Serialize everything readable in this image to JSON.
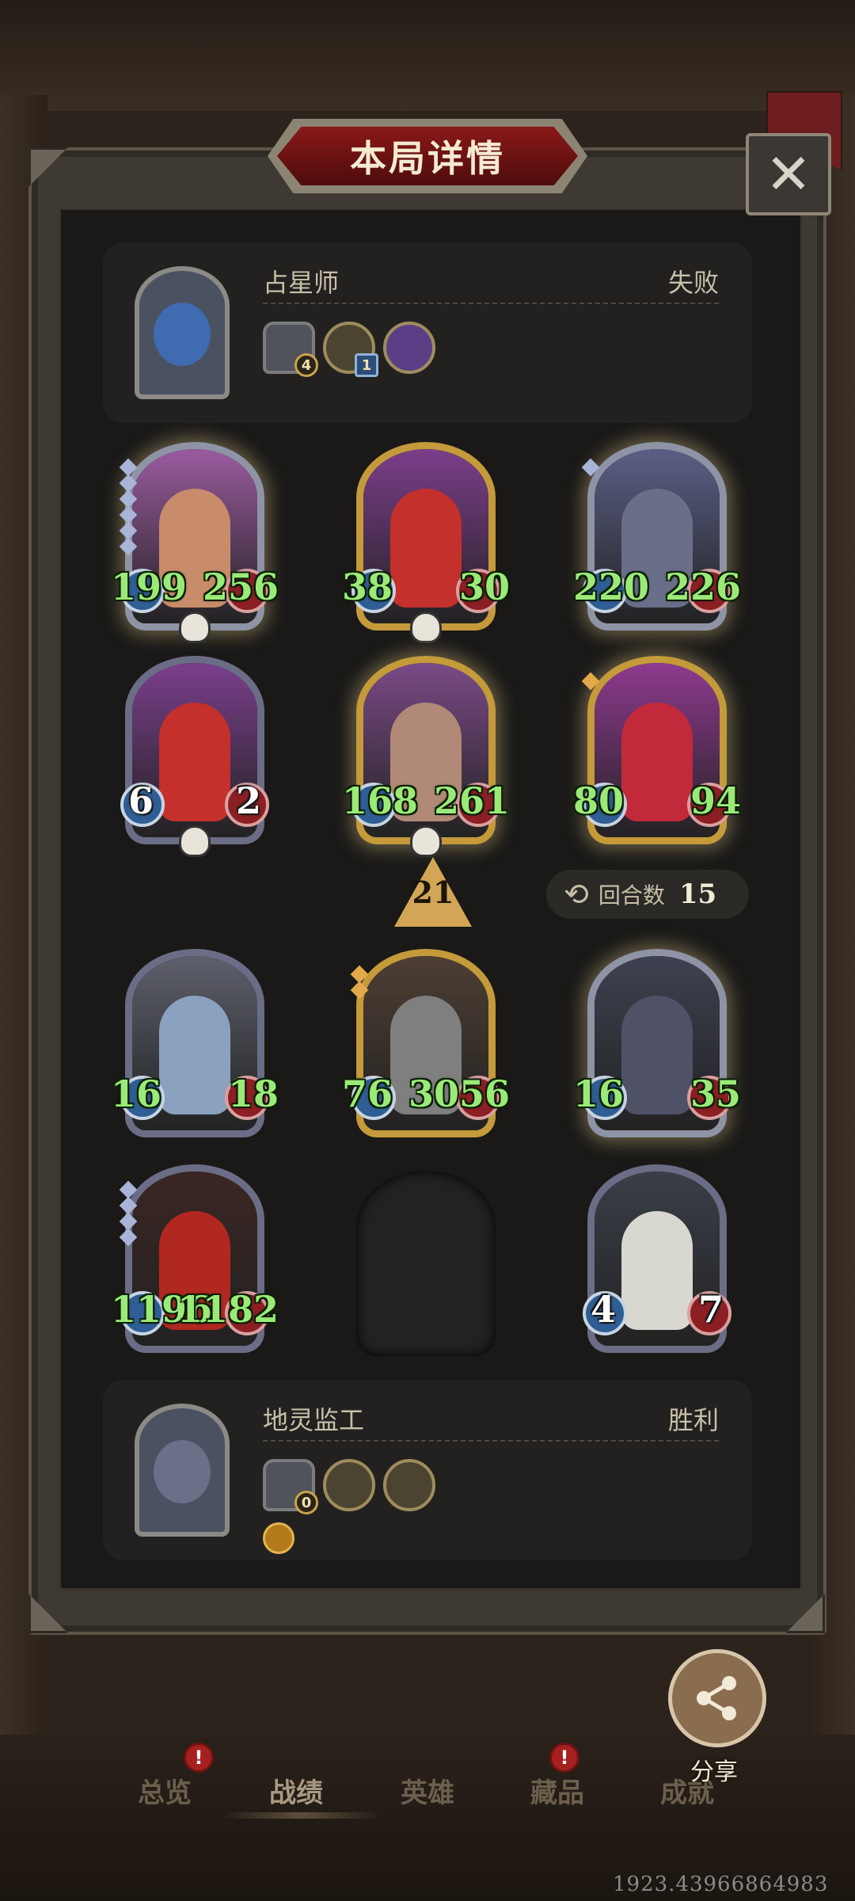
{
  "title": "本局详情",
  "close_icon": "close-icon",
  "top_player": {
    "name": "占星师",
    "result": "失败",
    "items": [
      {
        "icon": "shield-item-icon",
        "badge": "4"
      },
      {
        "icon": "orb-item-icon",
        "badge": "1"
      },
      {
        "icon": "scroll-item-icon",
        "badge": ""
      }
    ]
  },
  "units": [
    {
      "attack": "199",
      "health": "256",
      "frame": "silver",
      "art": "#9a5b9f",
      "figure": "#c98c6a",
      "glow": true,
      "tier": 6,
      "tier_color": "silver",
      "skull": true
    },
    {
      "attack": "38",
      "health": "30",
      "frame": "gold",
      "art": "#7b3e8a",
      "figure": "#c4302c",
      "glow": false,
      "tier": 0,
      "skull": true
    },
    {
      "attack": "220",
      "health": "226",
      "frame": "silver",
      "art": "#5a5f86",
      "figure": "#6a6e88",
      "glow": true,
      "tier": 1,
      "tier_color": "silver",
      "skull": false
    },
    {
      "attack": "6",
      "health": "2",
      "frame": "purple",
      "art": "#7a3f8c",
      "figure": "#c4302c",
      "glow": false,
      "tier": 0,
      "skull": true,
      "white": true
    },
    {
      "attack": "168",
      "health": "261",
      "frame": "gold",
      "art": "#7a4a86",
      "figure": "#b08a76",
      "glow": true,
      "tier": 0,
      "skull": true
    },
    {
      "attack": "80",
      "health": "94",
      "frame": "gold",
      "art": "#8e3a8e",
      "figure": "#c2293a",
      "glow": true,
      "tier": 1,
      "tier_color": "gold",
      "skull": false
    },
    {
      "attack": "16",
      "health": "18",
      "frame": "purple",
      "art": "#5d5f6b",
      "figure": "#8aa2bf",
      "glow": false,
      "tier": 0,
      "skull": false
    },
    {
      "attack": "76",
      "health": "3056",
      "frame": "gold",
      "art": "#4d3e33",
      "figure": "#7f7f7f",
      "glow": false,
      "tier": 2,
      "tier_color": "gold",
      "skull": false
    },
    {
      "attack": "16",
      "health": "35",
      "frame": "silver",
      "art": "#3e4150",
      "figure": "#4f5266",
      "glow": true,
      "tier": 0,
      "skull": false
    },
    {
      "attack": "1196",
      "health": "1182",
      "frame": "purple",
      "art": "#3b2623",
      "figure": "#b02820",
      "glow": false,
      "tier": 4,
      "tier_color": "silver",
      "skull": false
    },
    {
      "attack": "4",
      "health": "7",
      "frame": "purple",
      "art": "#3a3f48",
      "figure": "#d8d8d0",
      "glow": false,
      "tier": 0,
      "skull": false,
      "white": true
    }
  ],
  "level": "21",
  "rounds": {
    "label": "回合数",
    "value": "15",
    "icon": "refresh-icon"
  },
  "bottom_player": {
    "name": "地灵监工",
    "result": "胜利",
    "items": [
      {
        "icon": "shield-item-icon",
        "badge": "0"
      },
      {
        "icon": "lighter-item-icon",
        "badge": ""
      },
      {
        "icon": "hammer-item-icon",
        "badge": ""
      }
    ]
  },
  "share": {
    "label": "分享",
    "icon": "share-icon"
  },
  "nav": {
    "tabs": [
      {
        "label": "总览",
        "badge": "!"
      },
      {
        "label": "战绩",
        "badge": ""
      },
      {
        "label": "英雄",
        "badge": ""
      },
      {
        "label": "藏品",
        "badge": "!"
      },
      {
        "label": "成就",
        "badge": ""
      }
    ],
    "active": "战绩"
  },
  "coordinates": "1923.43966864983",
  "colors": {
    "stat_green": "#9bea78",
    "title_red": "#8a1818",
    "gold_frame": "#c49a3a"
  }
}
